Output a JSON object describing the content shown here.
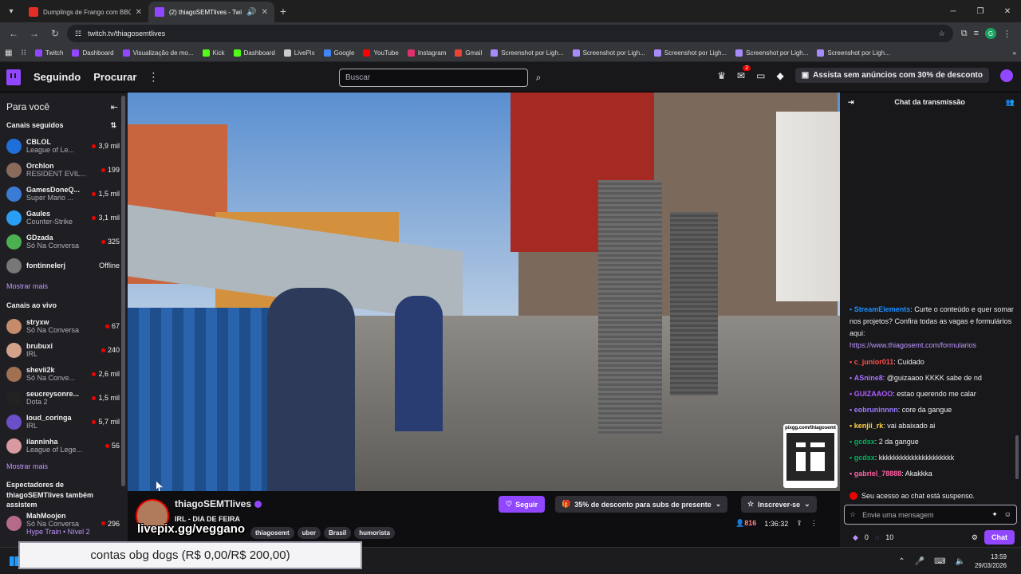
{
  "browser": {
    "tabs": [
      {
        "title": "Dumplings de Frango com BBQ",
        "active": false,
        "favicon_color": "#e52d27"
      },
      {
        "title": "(2) thiagoSEMTlives - Twitch",
        "active": true,
        "favicon_color": "#9147ff"
      }
    ],
    "url": "twitch.tv/thiagosemtlives",
    "bookmarks": [
      {
        "label": "Twitch",
        "icon_color": "#9147ff"
      },
      {
        "label": "Dashboard",
        "icon_color": "#9147ff"
      },
      {
        "label": "Visualização de mo...",
        "icon_color": "#9147ff"
      },
      {
        "label": "Kick",
        "icon_color": "#53fc18"
      },
      {
        "label": "Dashboard",
        "icon_color": "#53fc18"
      },
      {
        "label": "LivePix",
        "icon_color": "#cccccc"
      },
      {
        "label": "Google",
        "icon_color": "#4285f4"
      },
      {
        "label": "YouTube",
        "icon_color": "#ff0000"
      },
      {
        "label": "Instagram",
        "icon_color": "#e1306c"
      },
      {
        "label": "Gmail",
        "icon_color": "#ea4335"
      },
      {
        "label": "Screenshot por Ligh...",
        "icon_color": "#a78bfa"
      },
      {
        "label": "Screenshot por Ligh...",
        "icon_color": "#a78bfa"
      },
      {
        "label": "Screenshot por Ligh...",
        "icon_color": "#a78bfa"
      },
      {
        "label": "Screenshot por Ligh...",
        "icon_color": "#a78bfa"
      },
      {
        "label": "Screenshot por Ligh...",
        "icon_color": "#a78bfa"
      }
    ],
    "profile_initial": "G"
  },
  "nav": {
    "following": "Seguindo",
    "browse": "Procurar",
    "search_placeholder": "Buscar",
    "notification_count": "2",
    "promo": "Assista sem anúncios com 30% de desconto"
  },
  "sidebar": {
    "title": "Para você",
    "followed_title": "Canais seguidos",
    "followed": [
      {
        "name": "CBLOL",
        "game": "League of Le...",
        "viewers": "3,9 mil",
        "color": "#1e6fd9"
      },
      {
        "name": "Orchlon",
        "game": "RESIDENT EVIL...",
        "viewers": "199",
        "color": "#8a6a5a"
      },
      {
        "name": "GamesDoneQ...",
        "game": "Super Mario ...",
        "viewers": "1,5 mil",
        "color": "#3a7bd5"
      },
      {
        "name": "Gaules",
        "game": "Counter-Strike",
        "viewers": "3,1 mil",
        "color": "#2a9df4"
      },
      {
        "name": "GDzada",
        "game": "Só Na Conversa",
        "viewers": "325",
        "color": "#4caf50"
      },
      {
        "name": "fontinnelerj",
        "game": "",
        "viewers": "Offline",
        "color": "#777777"
      }
    ],
    "show_more": "Mostrar mais",
    "live_title": "Canais ao vivo",
    "live": [
      {
        "name": "stryxw",
        "game": "Só Na Conversa",
        "viewers": "67",
        "color": "#c58b6a"
      },
      {
        "name": "brubuxi",
        "game": "IRL",
        "viewers": "240",
        "color": "#d4a28a"
      },
      {
        "name": "shevii2k",
        "game": "Só Na Conve...",
        "viewers": "2,6 mil",
        "color": "#a07050"
      },
      {
        "name": "seucreysonre...",
        "game": "Dota 2",
        "viewers": "1,5 mil",
        "color": "#222222"
      },
      {
        "name": "loud_coringa",
        "game": "IRL",
        "viewers": "5,7 mil",
        "color": "#6a4fc8"
      },
      {
        "name": "ilanninha",
        "game": "League of Lege...",
        "viewers": "56",
        "color": "#d89aa0"
      }
    ],
    "show_more_2": "Mostrar mais",
    "also_watch": "Espectadores de thiagoSEMTlives também assistem",
    "also": [
      {
        "name": "MahMoojen",
        "game": "Só Na Conversa",
        "viewers": "296",
        "sub": "Hype Train • Nível 2",
        "color": "#b56a8a"
      }
    ]
  },
  "video": {
    "qr_caption": "pixgg.com/thiagosemt"
  },
  "chat": {
    "title": "Chat da transmissão",
    "messages": [
      {
        "user": "StreamElements",
        "color": "#1e90ff",
        "text": ": Curte o conteúdo e quer somar nos projetos? Confira todas as vagas e formulários aqui:",
        "link": "https://www.thiagosemt.com/formularios"
      },
      {
        "user": "c_junior011",
        "color": "#ff4d4d",
        "text": ": Cuidado"
      },
      {
        "user": "ASnine8",
        "color": "#a970ff",
        "text": ": @guizaaoo KKKK sabe de nd"
      },
      {
        "user": "GUIZAAOO",
        "color": "#b05cff",
        "text": ": estao querendo me calar"
      },
      {
        "user": "eobruninnnn",
        "color": "#9b7bff",
        "text": ": core da gangue"
      },
      {
        "user": "kenjii_rk",
        "color": "#ffd23f",
        "text": ": vai abaixado ai"
      },
      {
        "user": "gcdsx",
        "color": "#00b15a",
        "text": ": 2 da gangue"
      },
      {
        "user": "gcdsx",
        "color": "#00b15a",
        "text": ": kkkkkkkkkkkkkkkkkkkkk"
      },
      {
        "user": "gabriel_78888",
        "color": "#ff5fa2",
        "text": ": Akakkka"
      }
    ],
    "suspended": "Seu acesso ao chat está suspenso.",
    "input_placeholder": "Envie uma mensagem",
    "points": "0",
    "channel_points": "10",
    "chat_button": "Chat"
  },
  "channel": {
    "name": "thiagoSEMTlives",
    "title": "IRL - DIA DE FEIRA",
    "tags": [
      "thiagosemt",
      "uber",
      "Brasil",
      "humorista"
    ],
    "follow": "Seguir",
    "subs_discount": "35% de desconto para subs de presente",
    "subscribe": "Inscrever-se",
    "viewers": "816",
    "uptime": "1:36:32"
  },
  "overlay": {
    "livepix": "livepix.gg/veggano",
    "goal": "contas obg dogs (R$ 0,00/R$ 200,00)"
  },
  "taskbar": {
    "time": "13:59",
    "date": "29/03/2026"
  }
}
